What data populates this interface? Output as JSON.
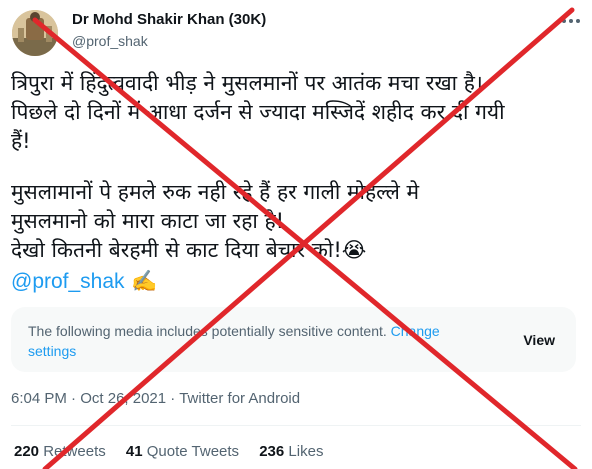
{
  "author": {
    "name": "Dr Mohd Shakir Khan (30K)",
    "handle": "@prof_shak"
  },
  "tweet": {
    "lines": [
      "त्रिपुरा में हिंदुत्ववादी भीड़ ने मुसलमानों पर आतंक मचा रखा है।",
      "पिछले दो दिनों में आधा दर्जन से ज्यादा मस्जिदें शहीद कर दी गयी",
      "हैं!",
      " मुसलामानों पे हमले रुक नही रहे हैं  हर गाली मोहल्ले मे",
      "मुसलमानो को मारा काटा जा रहा है!",
      "देखो कितनी बेरहमी से काट दिया बेचारे को!😭"
    ],
    "mention": "@prof_shak",
    "mention_emoji": "✍️"
  },
  "media_warning": {
    "text": "The following media includes potentially sensitive content.",
    "link": "Change settings",
    "view_label": "View"
  },
  "meta": {
    "time": "6:04 PM",
    "date": "Oct 26, 2021",
    "separator": "·",
    "source": "Twitter for Android"
  },
  "stats": {
    "retweets_count": "220",
    "retweets_label": "Retweets",
    "quotes_count": "41",
    "quotes_label": "Quote Tweets",
    "likes_count": "236",
    "likes_label": "Likes"
  },
  "overlay": {
    "color": "#e0272b",
    "type": "red-cross"
  }
}
